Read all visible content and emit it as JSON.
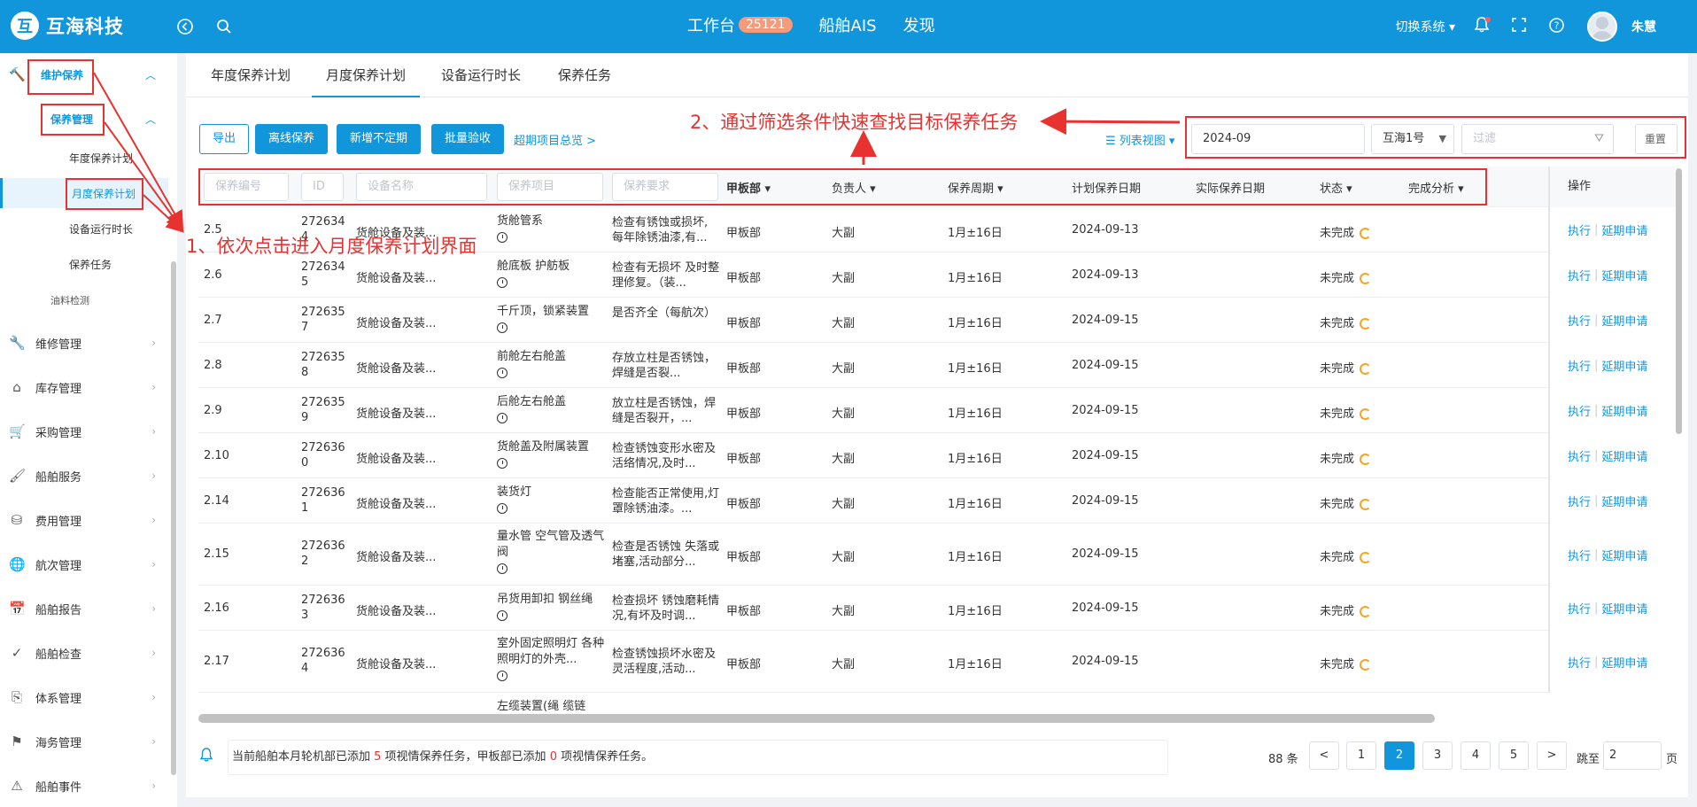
{
  "header": {
    "logo_text": "互海科技",
    "logo_mark": "互",
    "nav": [
      {
        "label": "工作台",
        "badge": "25121"
      },
      {
        "label": "船舶AIS"
      },
      {
        "label": "发现"
      }
    ],
    "switch_system": "切换系统 ▾",
    "user_name": "朱慧"
  },
  "sidebar": {
    "group_top": "维护保养",
    "group_sub": "保养管理",
    "sub_items": [
      "年度保养计划",
      "月度保养计划",
      "设备运行时长",
      "保养任务"
    ],
    "oil_check": "油料检测",
    "items": [
      {
        "label": "维修管理",
        "icon": "wrench-icon",
        "glyph": "🔧"
      },
      {
        "label": "库存管理",
        "icon": "home-icon",
        "glyph": "⌂"
      },
      {
        "label": "采购管理",
        "icon": "cart-icon",
        "glyph": "🛒"
      },
      {
        "label": "船舶服务",
        "icon": "brush-icon",
        "glyph": "🖌"
      },
      {
        "label": "费用管理",
        "icon": "database-icon",
        "glyph": "⛁"
      },
      {
        "label": "航次管理",
        "icon": "globe-icon",
        "glyph": "🌐"
      },
      {
        "label": "船舶报告",
        "icon": "calendar-icon",
        "glyph": "📅"
      },
      {
        "label": "船舶检查",
        "icon": "check-circle-icon",
        "glyph": "✓"
      },
      {
        "label": "体系管理",
        "icon": "copy-icon",
        "glyph": "⎘"
      },
      {
        "label": "海务管理",
        "icon": "signpost-icon",
        "glyph": "⚑"
      },
      {
        "label": "船舶事件",
        "icon": "warning-icon",
        "glyph": "⚠"
      }
    ]
  },
  "tabs": [
    "年度保养计划",
    "月度保养计划",
    "设备运行时长",
    "保养任务"
  ],
  "toolbar": {
    "export": "导出",
    "offline": "离线保养",
    "add_irregular": "新增不定期",
    "batch_accept": "批量验收",
    "overdue_link": "超期项目总览 >",
    "view_mode": "☰ 列表视图 ▾"
  },
  "filters": {
    "month": "2024-09",
    "ship": "互海1号",
    "filter_placeholder": "过滤",
    "reset": "重置"
  },
  "table": {
    "ph_code": "保养编号",
    "ph_id": "ID",
    "ph_equipment": "设备名称",
    "ph_item": "保养项目",
    "ph_req": "保养要求",
    "h_dept": "甲板部 ▾",
    "h_owner": "负责人 ▾",
    "h_cycle": "保养周期 ▾",
    "h_plan": "计划保养日期",
    "h_actual": "实际保养日期",
    "h_status": "状态 ▾",
    "h_analysis": "完成分析 ▾",
    "h_op": "操作",
    "op_exec": "执行",
    "op_extend": "延期申请",
    "rows": [
      {
        "code": "2.5",
        "id": "2726344",
        "eq": "货舱设备及装...",
        "item": "货舱管系",
        "req": "检查有锈蚀或损坏, 每年除锈油漆,有...",
        "dept": "甲板部",
        "owner": "大副",
        "cycle": "1月±16日",
        "plan": "2024-09-13",
        "status": "未完成"
      },
      {
        "code": "2.6",
        "id": "2726345",
        "eq": "货舱设备及装...",
        "item": "舱底板 护舫板",
        "req": "检查有无损坏 及时整理修复。（装...",
        "dept": "甲板部",
        "owner": "大副",
        "cycle": "1月±16日",
        "plan": "2024-09-13",
        "status": "未完成"
      },
      {
        "code": "2.7",
        "id": "2726357",
        "eq": "货舱设备及装...",
        "item": "千斤顶，锁紧装置",
        "req": "是否齐全（每航次）",
        "dept": "甲板部",
        "owner": "大副",
        "cycle": "1月±16日",
        "plan": "2024-09-15",
        "status": "未完成"
      },
      {
        "code": "2.8",
        "id": "2726358",
        "eq": "货舱设备及装...",
        "item": "前舱左右舱盖",
        "req": "存放立柱是否锈蚀，焊缝是否裂...",
        "dept": "甲板部",
        "owner": "大副",
        "cycle": "1月±16日",
        "plan": "2024-09-15",
        "status": "未完成"
      },
      {
        "code": "2.9",
        "id": "2726359",
        "eq": "货舱设备及装...",
        "item": "后舱左右舱盖",
        "req": "放立柱是否锈蚀，焊缝是否裂开，...",
        "dept": "甲板部",
        "owner": "大副",
        "cycle": "1月±16日",
        "plan": "2024-09-15",
        "status": "未完成"
      },
      {
        "code": "2.10",
        "id": "2726360",
        "eq": "货舱设备及装...",
        "item": "货舱盖及附属装置",
        "req": "检查锈蚀变形水密及活络情况,及时...",
        "dept": "甲板部",
        "owner": "大副",
        "cycle": "1月±16日",
        "plan": "2024-09-15",
        "status": "未完成"
      },
      {
        "code": "2.14",
        "id": "2726361",
        "eq": "货舱设备及装...",
        "item": "装货灯",
        "req": "检查能否正常使用,灯罩除锈油漆。...",
        "dept": "甲板部",
        "owner": "大副",
        "cycle": "1月±16日",
        "plan": "2024-09-15",
        "status": "未完成"
      },
      {
        "code": "2.15",
        "id": "2726362",
        "eq": "货舱设备及装...",
        "item": "量水管 空气管及透气阀",
        "req": "检查是否锈蚀 失落或堵塞,活动部分...",
        "dept": "甲板部",
        "owner": "大副",
        "cycle": "1月±16日",
        "plan": "2024-09-15",
        "status": "未完成"
      },
      {
        "code": "2.16",
        "id": "2726363",
        "eq": "货舱设备及装...",
        "item": "吊货用卸扣 钢丝绳",
        "req": "检查损坏 锈蚀磨耗情况,有坏及时调...",
        "dept": "甲板部",
        "owner": "大副",
        "cycle": "1月±16日",
        "plan": "2024-09-15",
        "status": "未完成"
      },
      {
        "code": "2.17",
        "id": "2726364",
        "eq": "货舱设备及装...",
        "item": "室外固定照明灯 各种照明灯的外壳...",
        "req": "检查锈蚀损坏水密及灵活程度,活动...",
        "dept": "甲板部",
        "owner": "大副",
        "cycle": "1月±16日",
        "plan": "2024-09-15",
        "status": "未完成"
      }
    ],
    "partial_row_text": "左缆装置(绳 缆链"
  },
  "notice": {
    "prefix": "当前船舶本月轮机部已添加 ",
    "engine_count": "5",
    "mid": " 项视情保养任务，甲板部已添加 ",
    "deck_count": "0",
    "suffix": " 项视情保养任务。"
  },
  "pager": {
    "total": "88 条",
    "prev": "<",
    "next": ">",
    "pages": [
      "1",
      "2",
      "3",
      "4",
      "5"
    ],
    "goto_label": "跳至",
    "goto_value": "2",
    "page_unit": "页"
  },
  "annotations": {
    "step1": "1、依次点击进入月度保养计划界面",
    "step2": "2、通过筛选条件快速查找目标保养任务"
  },
  "colors": {
    "accent": "#1296db",
    "annotation": "#e8322f",
    "status_warn": "#f5a623"
  }
}
